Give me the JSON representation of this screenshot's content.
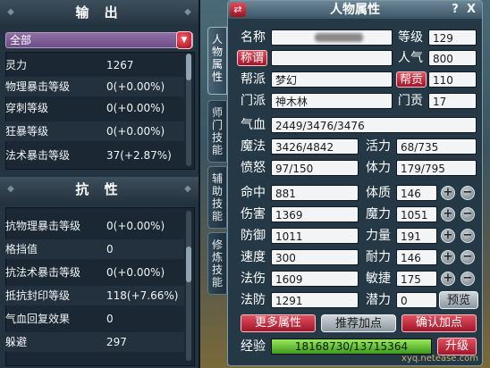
{
  "output": {
    "title": "输 出",
    "filter": "全部",
    "rows": [
      {
        "label": "灵力",
        "value": "1267"
      },
      {
        "label": "物理暴击等级",
        "value": "0(+0.00%)"
      },
      {
        "label": "穿刺等级",
        "value": "0(+0.00%)"
      },
      {
        "label": "狂暴等级",
        "value": "0(+0.00%)"
      },
      {
        "label": "法术暴击等级",
        "value": "37(+2.87%)"
      }
    ]
  },
  "resist": {
    "title": "抗 性",
    "rows": [
      {
        "label": "抗物理暴击等级",
        "value": "0(+0.00%)"
      },
      {
        "label": "格挡值",
        "value": "0"
      },
      {
        "label": "抗法术暴击等级",
        "value": "0(+0.00%)"
      },
      {
        "label": "抵抗封印等级",
        "value": "118(+7.66%)"
      },
      {
        "label": "气血回复效果",
        "value": "0"
      },
      {
        "label": "躲避",
        "value": "297"
      }
    ]
  },
  "side_tabs": [
    "人物属性",
    "师门技能",
    "辅助技能",
    "修炼技能"
  ],
  "panel": {
    "title": "人物属性",
    "help": "?",
    "close": "X",
    "swap_icon": "⇄",
    "name_label": "名称",
    "level_label": "等级",
    "level": "129",
    "title_btn": "称谓",
    "popularity_label": "人气",
    "popularity": "800",
    "guild_label": "帮派",
    "guild": "梦幻",
    "guild_contrib_btn": "帮贡",
    "guild_contrib": "110",
    "sect_label": "门派",
    "sect": "神木林",
    "sect_contrib_label": "门贡",
    "sect_contrib": "17",
    "hp_label": "气血",
    "hp": "2449/3476/3476",
    "mp_label": "魔法",
    "mp": "3426/4842",
    "vitality_label": "活力",
    "vitality": "68/735",
    "rage_label": "愤怒",
    "rage": "97/150",
    "stamina_label": "体力",
    "stamina": "179/795",
    "combat": [
      {
        "label": "命中",
        "value": "881"
      },
      {
        "label": "伤害",
        "value": "1369"
      },
      {
        "label": "防御",
        "value": "1011"
      },
      {
        "label": "速度",
        "value": "300"
      },
      {
        "label": "法伤",
        "value": "1609"
      },
      {
        "label": "法防",
        "value": "1291"
      }
    ],
    "attributes": [
      {
        "label": "体质",
        "value": "146"
      },
      {
        "label": "魔力",
        "value": "1051"
      },
      {
        "label": "力量",
        "value": "191"
      },
      {
        "label": "耐力",
        "value": "146"
      },
      {
        "label": "敏捷",
        "value": "175"
      }
    ],
    "potential_label": "潜力",
    "potential": "0",
    "preview_btn": "预览",
    "more_attr_btn": "更多属性",
    "recommend_btn": "推荐加点",
    "confirm_btn": "确认加点",
    "exp_label": "经验",
    "exp": "18168730/13715364",
    "exp_fraction": 1.0,
    "upgrade_btn": "升级",
    "watermark": "xyq.netease.com"
  }
}
